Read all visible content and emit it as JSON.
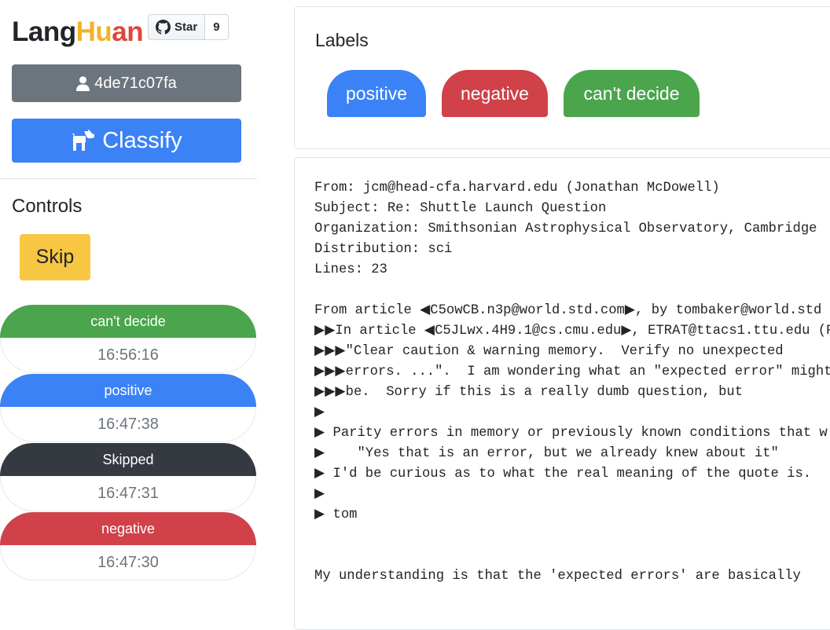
{
  "brand": {
    "part1": "Lang",
    "part2": "Hu",
    "part3": "an"
  },
  "github": {
    "star_label": "Star",
    "star_count": "9"
  },
  "user": {
    "id": "4de71c07fa"
  },
  "classify": {
    "label": "Classify"
  },
  "controls": {
    "heading": "Controls",
    "skip_label": "Skip"
  },
  "history": [
    {
      "label": "can't decide",
      "time": "16:56:16",
      "color": "#4aa54d"
    },
    {
      "label": "positive",
      "time": "16:47:38",
      "color": "#3b82f6"
    },
    {
      "label": "Skipped",
      "time": "16:47:31",
      "color": "#343a40"
    },
    {
      "label": "negative",
      "time": "16:47:30",
      "color": "#d04149"
    }
  ],
  "labels": {
    "heading": "Labels",
    "options": [
      {
        "label": "positive",
        "color": "#3b82f6"
      },
      {
        "label": "negative",
        "color": "#d04149"
      },
      {
        "label": "can't decide",
        "color": "#4aa54d"
      }
    ]
  },
  "text_lines": [
    "From: jcm@head-cfa.harvard.edu (Jonathan McDowell)",
    "Subject: Re: Shuttle Launch Question",
    "Organization: Smithsonian Astrophysical Observatory, Cambridge",
    "Distribution: sci",
    "Lines: 23",
    "",
    "From article ◀C5owCB.n3p@world.std.com▶, by tombaker@world.std",
    "▶▶In article ◀C5JLwx.4H9.1@cs.cmu.edu▶, ETRAT@ttacs1.ttu.edu (P",
    "▶▶▶\"Clear caution & warning memory.  Verify no unexpected",
    "▶▶▶errors. ...\".  I am wondering what an \"expected error\" might",
    "▶▶▶be.  Sorry if this is a really dumb question, but",
    "▶",
    "▶ Parity errors in memory or previously known conditions that w",
    "▶    \"Yes that is an error, but we already knew about it\"",
    "▶ I'd be curious as to what the real meaning of the quote is.",
    "▶",
    "▶ tom",
    "",
    "",
    "My understanding is that the 'expected errors' are basically"
  ]
}
